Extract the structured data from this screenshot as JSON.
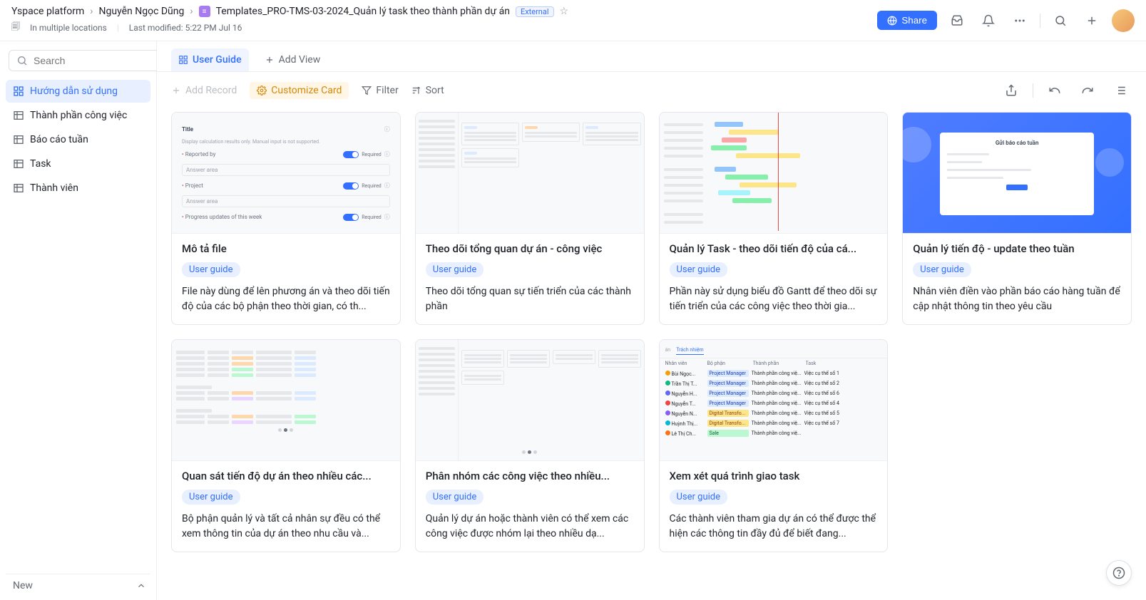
{
  "header": {
    "breadcrumb": [
      "Yspace platform",
      "Nguyễn Ngọc Dũng",
      "Templates_PRO-TMS-03-2024_Quản lý task theo thành phần dự án"
    ],
    "external_badge": "External",
    "locations": "In multiple locations",
    "last_modified": "Last modified: 5:22 PM Jul 16",
    "share_label": "Share"
  },
  "sidebar": {
    "search_placeholder": "Search",
    "items": [
      {
        "label": "Hướng dẫn sử dụng",
        "active": true
      },
      {
        "label": "Thành phần công việc",
        "active": false
      },
      {
        "label": "Báo cáo tuần",
        "active": false
      },
      {
        "label": "Task",
        "active": false
      },
      {
        "label": "Thành viên",
        "active": false
      }
    ],
    "bottom_label": "New"
  },
  "tabs": {
    "active": "User Guide",
    "add_view": "Add View"
  },
  "toolbar": {
    "add_record": "Add Record",
    "customize": "Customize Card",
    "filter": "Filter",
    "sort": "Sort"
  },
  "cards": [
    {
      "title": "Mô tả file",
      "tag": "User guide",
      "desc": "File này dùng để lên phương án và theo dõi tiến độ của các bộ phận theo thời gian, có th..."
    },
    {
      "title": "Theo dõi tổng quan dự án - công việc",
      "tag": "User guide",
      "desc": "Theo dõi tổng quan sự tiến triển của các thành phần"
    },
    {
      "title": "Quản lý Task - theo dõi tiến độ của cá...",
      "tag": "User guide",
      "desc": "Phần này sử dụng biểu đồ Gantt để theo dõi sự tiến triển của các công việc theo thời gia..."
    },
    {
      "title": "Quản lý tiến độ - update theo tuần",
      "tag": "User guide",
      "desc": "Nhân viên điền vào phần báo cáo hàng tuần để cập nhật thông tin theo yêu cầu"
    },
    {
      "title": "Quan sát tiến độ dự án theo nhiều các...",
      "tag": "User guide",
      "desc": "Bộ phận quản lý và tất cả nhân sự đều có thể xem thông tin của dự án theo nhu cầu và..."
    },
    {
      "title": "Phân nhóm các công việc theo nhiều...",
      "tag": "User guide",
      "desc": "Quản lý dự án hoặc thành viên có thể xem các công việc được nhóm lại theo nhiều dạ..."
    },
    {
      "title": "Xem xét quá trình giao task",
      "tag": "User guide",
      "desc": "Các thành viên tham gia dự án có thể được thể hiện các thông tin đầy đủ để biết đang..."
    }
  ],
  "thumbs": {
    "form": {
      "title": "Title",
      "hint": "Display calculation results only. Manual input is not supported.",
      "reported_by": "Reported by",
      "project": "Project",
      "progress": "Progress updates of this week",
      "required": "Required",
      "answer": "Answer area"
    },
    "weeklyform": {
      "title": "Gửi báo cáo tuần"
    },
    "tasktable": {
      "tab1": "án",
      "tab2": "Trách nhiệm",
      "cols": [
        "Nhân viên",
        "Bộ phận",
        "Thành phần",
        "Task"
      ],
      "roles": {
        "pm": "Project Manager",
        "dt": "Digital Transfo...",
        "sale": "Sale"
      }
    }
  }
}
